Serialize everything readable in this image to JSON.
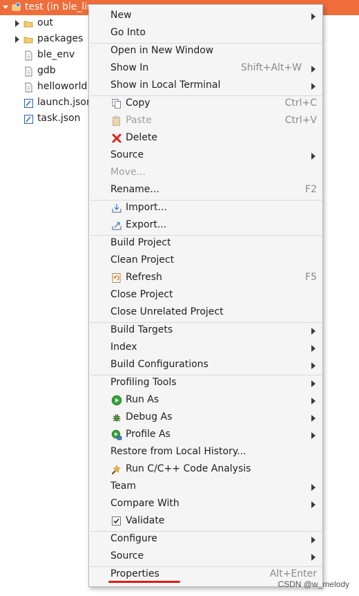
{
  "tree": {
    "header": {
      "label": "test (in ble_lin"
    },
    "items": [
      {
        "label": "out"
      },
      {
        "label": "packages"
      },
      {
        "label": "ble_env"
      },
      {
        "label": "gdb"
      },
      {
        "label": "helloworld"
      },
      {
        "label": "launch.json"
      },
      {
        "label": "task.json"
      }
    ]
  },
  "menu": {
    "new": {
      "label": "New"
    },
    "go_into": {
      "label": "Go Into"
    },
    "open_new_window": {
      "label": "Open in New Window"
    },
    "show_in": {
      "label": "Show In",
      "shortcut": "Shift+Alt+W"
    },
    "show_local_terminal": {
      "label": "Show in Local Terminal"
    },
    "copy": {
      "label": "Copy",
      "shortcut": "Ctrl+C"
    },
    "paste": {
      "label": "Paste",
      "shortcut": "Ctrl+V"
    },
    "delete": {
      "label": "Delete"
    },
    "source1": {
      "label": "Source"
    },
    "move": {
      "label": "Move..."
    },
    "rename": {
      "label": "Rename...",
      "shortcut": "F2"
    },
    "import": {
      "label": "Import..."
    },
    "export": {
      "label": "Export..."
    },
    "build_project": {
      "label": "Build Project"
    },
    "clean_project": {
      "label": "Clean Project"
    },
    "refresh": {
      "label": "Refresh",
      "shortcut": "F5"
    },
    "close_project": {
      "label": "Close Project"
    },
    "close_unrelated": {
      "label": "Close Unrelated Project"
    },
    "build_targets": {
      "label": "Build Targets"
    },
    "index": {
      "label": "Index"
    },
    "build_configurations": {
      "label": "Build Configurations"
    },
    "profiling_tools": {
      "label": "Profiling Tools"
    },
    "run_as": {
      "label": "Run As"
    },
    "debug_as": {
      "label": "Debug As"
    },
    "profile_as": {
      "label": "Profile As"
    },
    "restore_history": {
      "label": "Restore from Local History..."
    },
    "code_analysis": {
      "label": "Run C/C++ Code Analysis"
    },
    "team": {
      "label": "Team"
    },
    "compare_with": {
      "label": "Compare With"
    },
    "validate": {
      "label": "Validate"
    },
    "configure": {
      "label": "Configure"
    },
    "source2": {
      "label": "Source"
    },
    "properties": {
      "label": "Properties",
      "shortcut": "Alt+Enter"
    }
  },
  "watermark": "CSDN @w_melody",
  "colors": {
    "selection_header": "#ee6d3a",
    "menu_background": "#f5f5f5",
    "annotation_underline": "#e0191b"
  },
  "icons": [
    "project-icon",
    "folder-icon",
    "file-icon",
    "json-file-icon",
    "copy-icon",
    "paste-icon",
    "delete-icon",
    "import-icon",
    "export-icon",
    "refresh-icon",
    "run-icon",
    "debug-icon",
    "profile-icon",
    "code-analysis-icon",
    "checkbox-icon",
    "submenu-arrow-icon"
  ]
}
